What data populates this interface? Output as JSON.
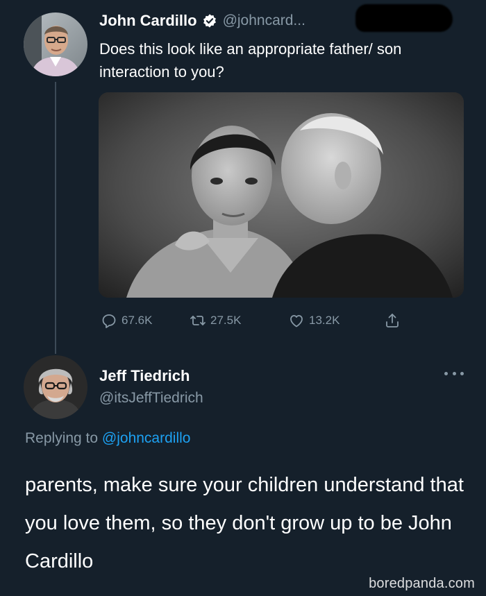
{
  "tweet": {
    "author": {
      "name": "John Cardillo",
      "handle": "@johncard...",
      "verified": true,
      "avatar": "profile-photo-man-glasses"
    },
    "text": "Does this look like an appropriate father/ son interaction to you?",
    "media": {
      "description": "black-and-white-photo",
      "kind": "image"
    },
    "actions": {
      "replies": "67.6K",
      "retweets": "27.5K",
      "likes": "13.2K",
      "reply_icon": "reply-icon",
      "retweet_icon": "retweet-icon",
      "like_icon": "heart-icon",
      "share_icon": "share-icon"
    }
  },
  "reply": {
    "author": {
      "name": "Jeff Tiedrich",
      "handle": "@itsJeffTiedrich",
      "avatar": "profile-photo-man-grey-hair-glasses"
    },
    "replying_label": "Replying to",
    "replying_to": "@johncardillo",
    "text": "parents, make sure your children understand that you love them, so they don't grow up to be John Cardillo",
    "more_icon": "more-icon"
  },
  "watermark": "boredpanda.com",
  "colors": {
    "background": "#15202b",
    "text": "#ffffff",
    "muted": "#8899a6",
    "link": "#1da1f2",
    "thread_line": "#3d4a57"
  }
}
